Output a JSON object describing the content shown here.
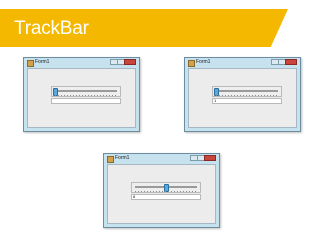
{
  "banner": {
    "title": "TrackBar",
    "color": "#f5b800"
  },
  "windows": [
    {
      "title": "Form1",
      "trackbar_value": 0.0,
      "textbox_value": ""
    },
    {
      "title": "Form1",
      "trackbar_value": 0.0,
      "textbox_value": "1"
    },
    {
      "title": "Form1",
      "trackbar_value": 0.5,
      "textbox_value": "8"
    }
  ]
}
